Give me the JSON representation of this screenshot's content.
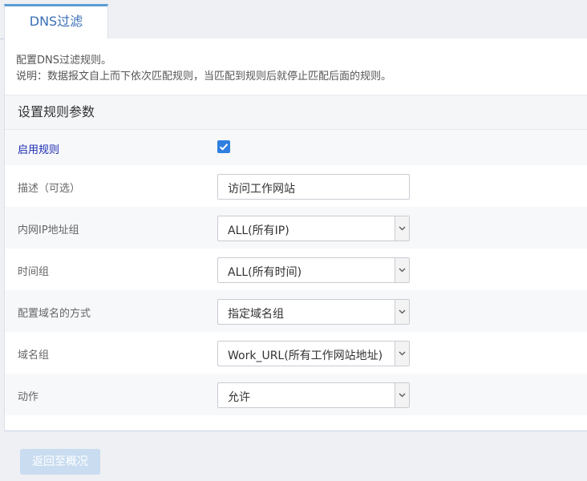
{
  "tab": {
    "label": "DNS过滤"
  },
  "description": {
    "line1": "配置DNS过滤规则。",
    "line2": "说明：数据报文自上而下依次匹配规则，当匹配到规则后就停止匹配后面的规则。"
  },
  "section": {
    "title": "设置规则参数"
  },
  "form": {
    "enable": {
      "label": "启用规则",
      "checked": true
    },
    "desc": {
      "label": "描述（可选）",
      "value": "访问工作网站"
    },
    "ip_group": {
      "label": "内网IP地址组",
      "value": "ALL(所有IP)"
    },
    "time_group": {
      "label": "时间组",
      "value": "ALL(所有时间)"
    },
    "domain_mode": {
      "label": "配置域名的方式",
      "value": "指定域名组"
    },
    "domain_group": {
      "label": "域名组",
      "value": "Work_URL(所有工作网站地址)"
    },
    "action": {
      "label": "动作",
      "value": "允许"
    }
  },
  "footer": {
    "back_label": "返回至概况"
  },
  "colors": {
    "accent": "#2f7fe0",
    "tab_text": "#3a6fb7",
    "button_disabled": "#c9dcf0"
  }
}
